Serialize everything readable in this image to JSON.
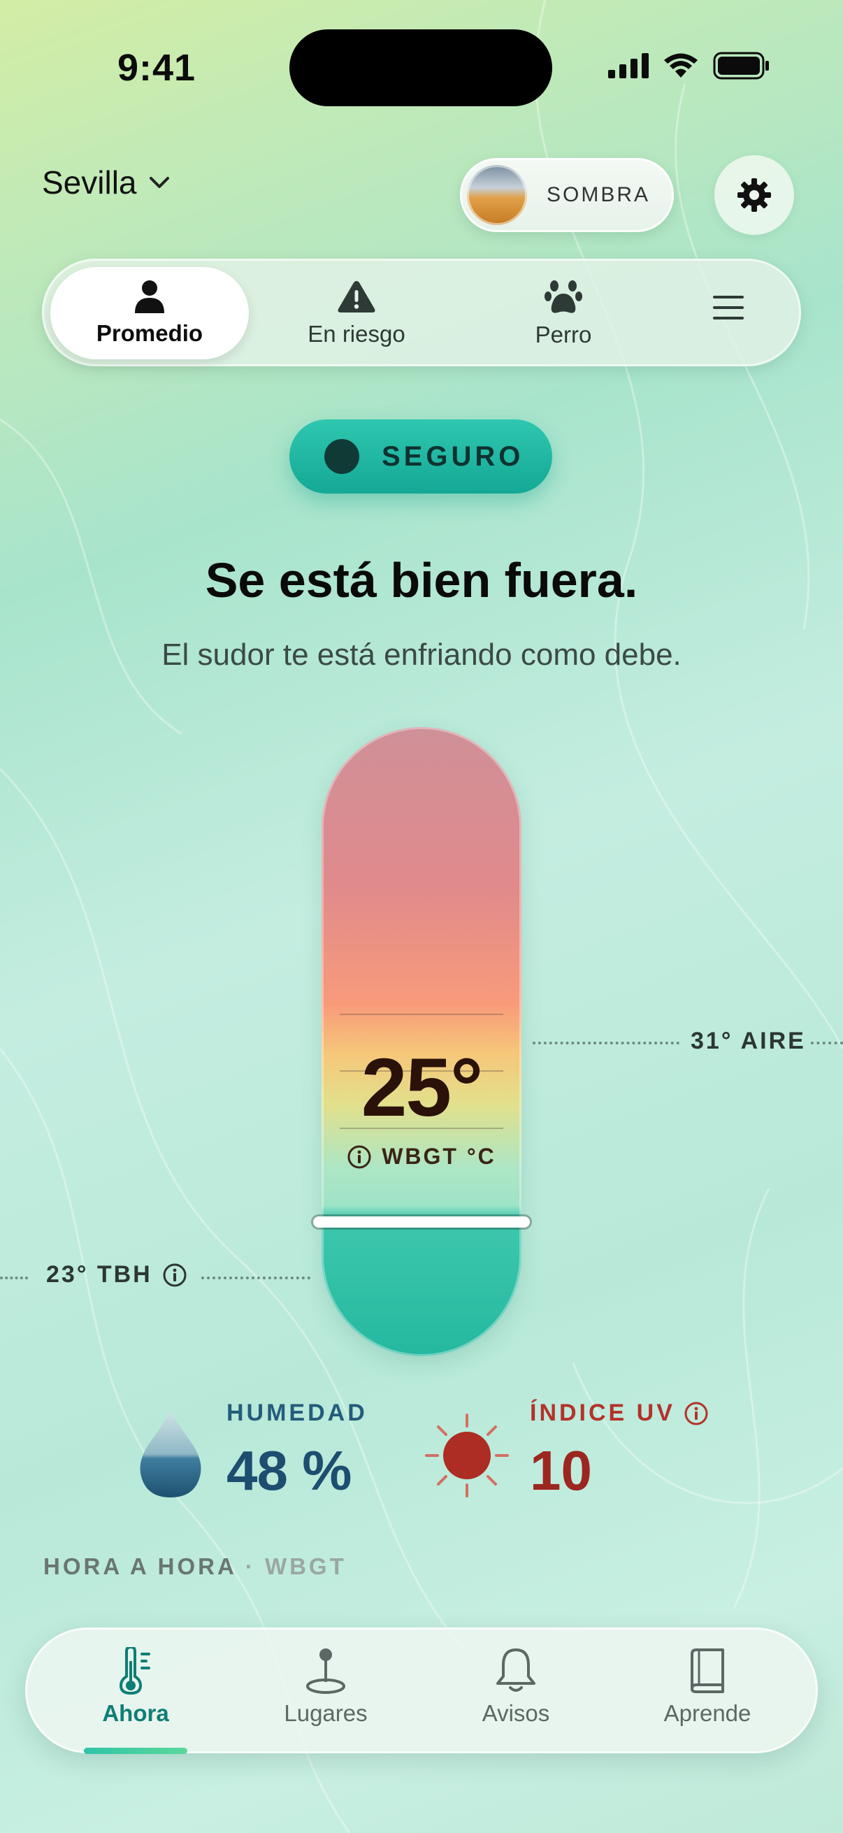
{
  "status_bar": {
    "time": "9:41"
  },
  "header": {
    "city": "Sevilla",
    "shade_toggle": "SOMBRA"
  },
  "profiles": {
    "items": [
      {
        "label": "Promedio",
        "icon": "person-icon",
        "active": true
      },
      {
        "label": "En riesgo",
        "icon": "warning-icon",
        "active": false
      },
      {
        "label": "Perro",
        "icon": "paw-icon",
        "active": false
      }
    ],
    "menu_icon": "menu-icon"
  },
  "status": {
    "badge": "SEGURO",
    "headline": "Se está bien fuera.",
    "subline": "El sudor te está enfriando como debe."
  },
  "thermometer": {
    "value": "25°",
    "unit_label": "WBGT °C",
    "air": "31° AIRE",
    "tbh": "23° TBH"
  },
  "stats": {
    "humidity_label": "HUMEDAD",
    "humidity_value": "48 %",
    "uv_label": "ÍNDICE UV",
    "uv_value": "10"
  },
  "hourly": {
    "title": "HORA A HORA",
    "subtitle": "· WBGT"
  },
  "nav": {
    "items": [
      {
        "label": "Ahora",
        "icon": "thermometer-icon",
        "active": true
      },
      {
        "label": "Lugares",
        "icon": "location-pin-icon",
        "active": false
      },
      {
        "label": "Avisos",
        "icon": "bell-icon",
        "active": false
      },
      {
        "label": "Aprende",
        "icon": "book-icon",
        "active": false
      }
    ]
  },
  "colors": {
    "accent_teal": "#14a895",
    "humidity_blue": "#1d4e70",
    "uv_red": "#9c2620"
  }
}
